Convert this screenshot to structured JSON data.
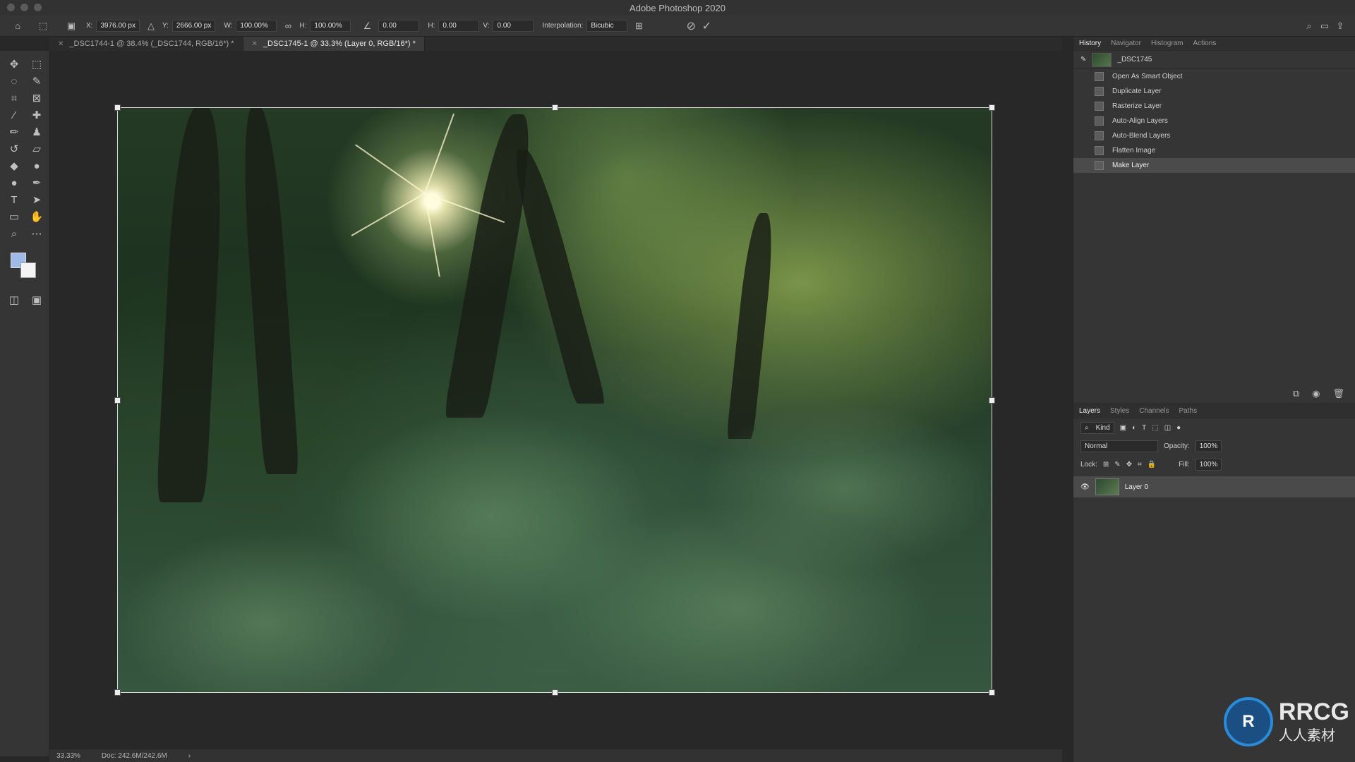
{
  "window": {
    "title": "Adobe Photoshop 2020"
  },
  "options": {
    "x_label": "X:",
    "x_value": "3976.00 px",
    "y_label": "Y:",
    "y_value": "2666.00 px",
    "w_label": "W:",
    "w_value": "100.00%",
    "h_label": "H:",
    "h_value": "100.00%",
    "angle_value": "0.00",
    "hskew_label": "H:",
    "hskew_value": "0.00",
    "vskew_label": "V:",
    "vskew_value": "0.00",
    "interp_label": "Interpolation:",
    "interp_value": "Bicubic"
  },
  "doc_tabs": [
    {
      "label": "_DSC1744-1 @ 38.4% (_DSC1744, RGB/16*) *",
      "active": false
    },
    {
      "label": "_DSC1745-1 @ 33.3% (Layer 0, RGB/16*) *",
      "active": true
    }
  ],
  "history": {
    "tabs": [
      "History",
      "Navigator",
      "Histogram",
      "Actions"
    ],
    "snapshot": "_DSC1745",
    "items": [
      "Open As Smart Object",
      "Duplicate Layer",
      "Rasterize Layer",
      "Auto-Align Layers",
      "Auto-Blend Layers",
      "Flatten Image",
      "Make Layer"
    ],
    "selected_index": 6
  },
  "layers_panel": {
    "tabs": [
      "Layers",
      "Styles",
      "Channels",
      "Paths"
    ],
    "filter_kind": "Kind",
    "blend_mode": "Normal",
    "opacity_label": "Opacity:",
    "opacity_value": "100%",
    "lock_label": "Lock:",
    "fill_label": "Fill:",
    "fill_value": "100%",
    "layer_name": "Layer 0"
  },
  "status": {
    "zoom": "33.33%",
    "doc": "Doc: 242.6M/242.6M"
  },
  "watermark": {
    "name": "RRCG",
    "sub": "人人素材"
  },
  "colors": {
    "foreground": "#9fb9e8",
    "background": "#f4f4f4",
    "accent": "#2a8bd8"
  }
}
